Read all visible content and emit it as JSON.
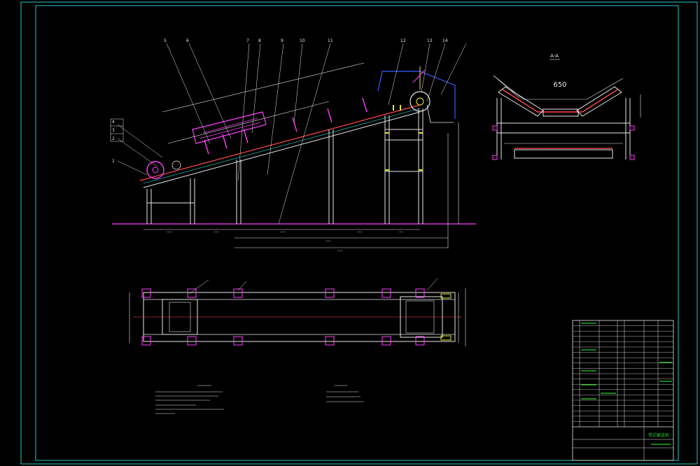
{
  "colors": {
    "background": "#000000",
    "frame": "#22c7c7",
    "structure": "#e8e8e8",
    "belt": "#ff4a4a",
    "magenta": "#ff3cff",
    "blue": "#3a5bff",
    "green": "#2ad02a",
    "yellow": "#e8e82a",
    "cyan": "#2ae0e0"
  },
  "drawing": {
    "section_label": "A-A",
    "trough_width": "650",
    "leader_numbers": [
      "1",
      "2",
      "3",
      "4",
      "5",
      "6",
      "7",
      "8",
      "9",
      "10",
      "11",
      "12",
      "13",
      "14"
    ]
  },
  "title_block": {
    "title": "带式输送机",
    "rows": 20
  }
}
